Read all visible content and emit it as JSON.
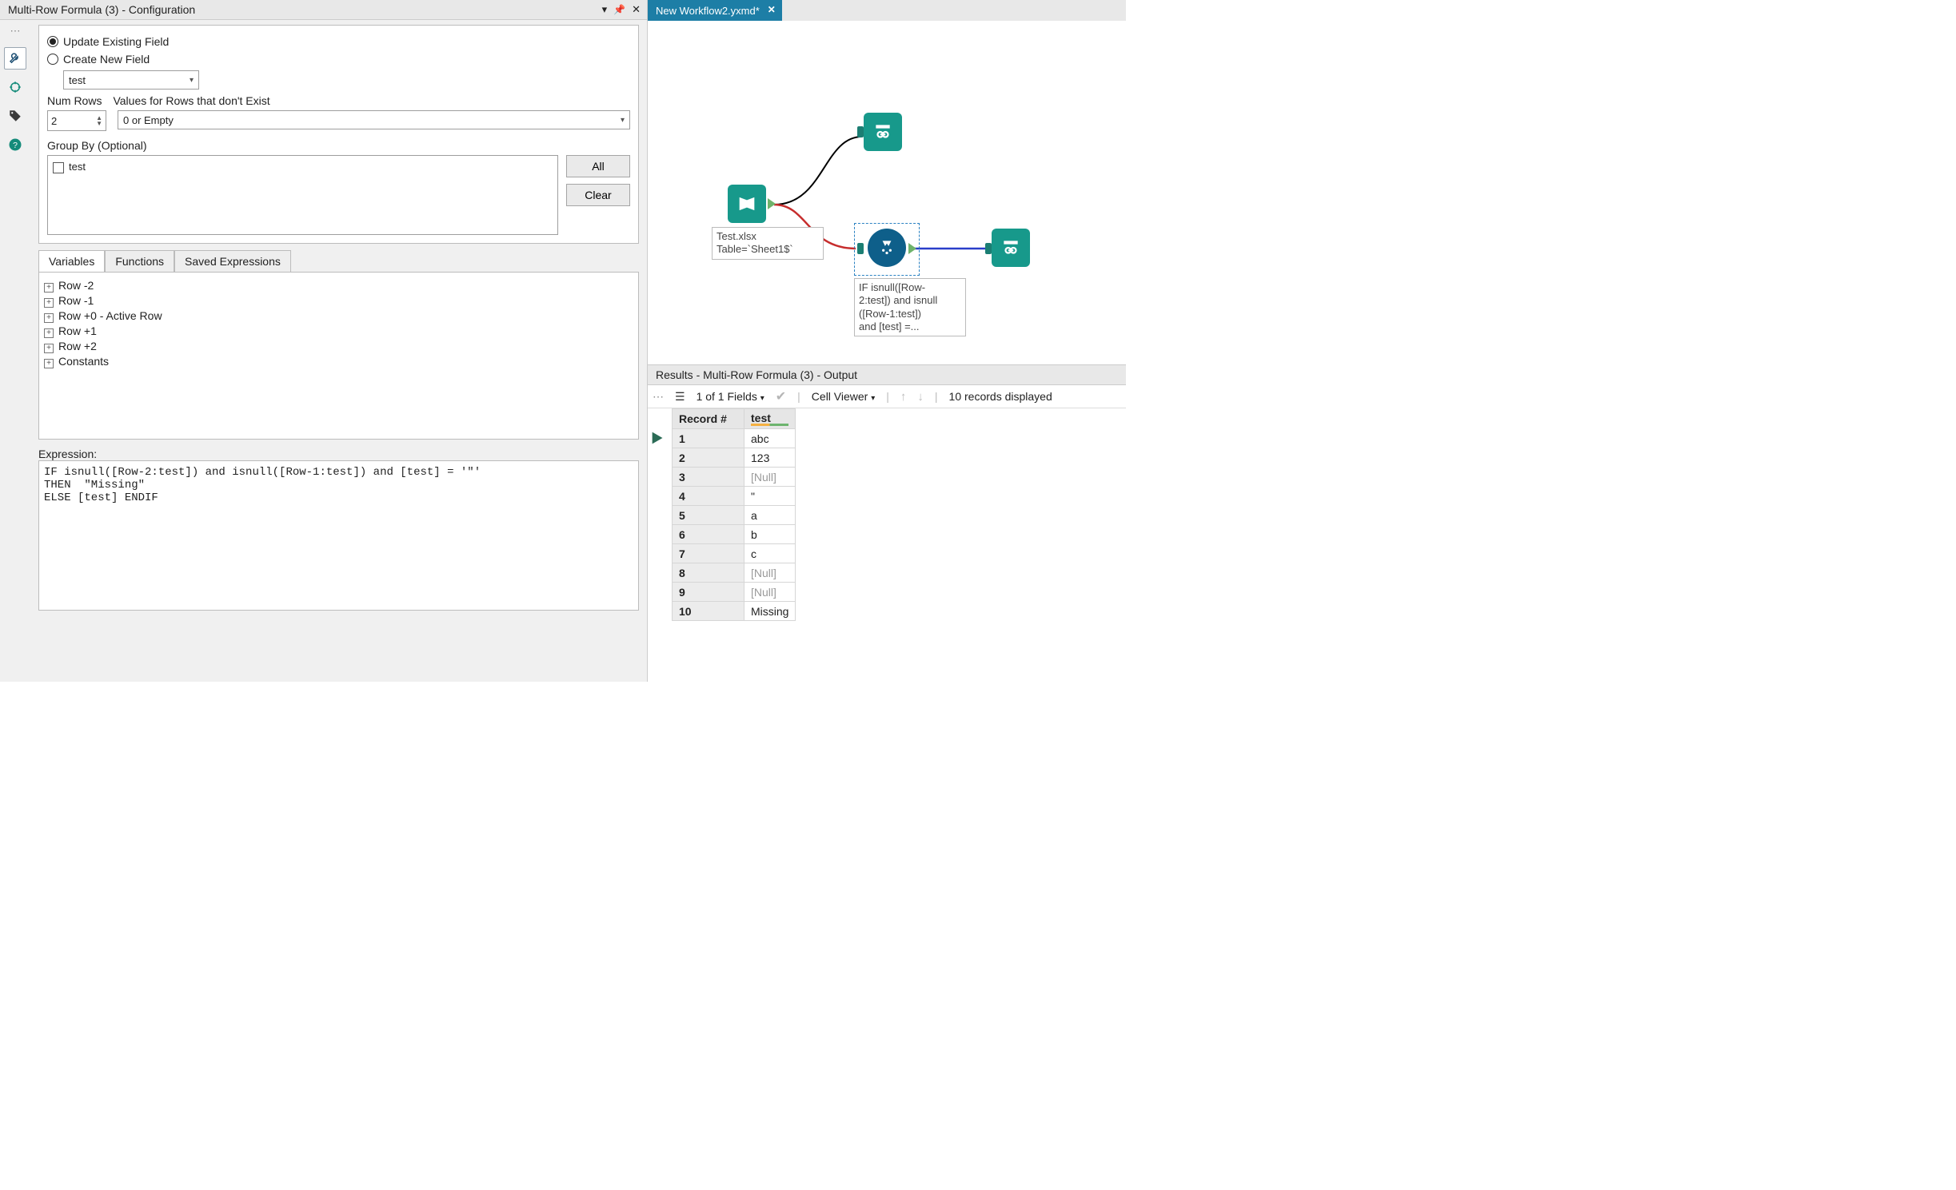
{
  "config_panel": {
    "title": "Multi-Row Formula (3) - Configuration",
    "radio_update": "Update Existing Field",
    "radio_create": "Create New  Field",
    "field_value": "test",
    "numrows_label": "Num Rows",
    "numrows_value": "2",
    "values_label": "Values for Rows that don't Exist",
    "values_value": "0 or Empty",
    "groupby_label": "Group By (Optional)",
    "groupby_item": "test",
    "btn_all": "All",
    "btn_clear": "Clear",
    "tabs": {
      "variables": "Variables",
      "functions": "Functions",
      "saved": "Saved Expressions"
    },
    "tree": [
      "Row -2",
      "Row -1",
      "Row +0 - Active Row",
      "Row +1",
      "Row +2",
      "Constants"
    ],
    "expr_label": "Expression:",
    "expression": "IF isnull([Row-2:test]) and isnull([Row-1:test]) and [test] = '\"'\nTHEN  \"Missing\"\nELSE [test] ENDIF"
  },
  "canvas": {
    "doc_tab": "New Workflow2.yxmd*",
    "input_label_l1": "Test.xlsx",
    "input_label_l2": "Table=`Sheet1$`",
    "mrf_label_l1": "IF isnull([Row-",
    "mrf_label_l2": "2:test]) and isnull",
    "mrf_label_l3": "([Row-1:test])",
    "mrf_label_l4": "and [test] =..."
  },
  "results": {
    "title": "Results - Multi-Row Formula (3) - Output",
    "fields_text": "1 of 1 Fields",
    "cellviewer": "Cell Viewer",
    "count_text": "10 records displayed",
    "columns": [
      "Record #",
      "test"
    ],
    "rows": [
      {
        "n": "1",
        "v": "abc",
        "null": false
      },
      {
        "n": "2",
        "v": "123",
        "null": false
      },
      {
        "n": "3",
        "v": "[Null]",
        "null": true
      },
      {
        "n": "4",
        "v": "\"",
        "null": false
      },
      {
        "n": "5",
        "v": "a",
        "null": false
      },
      {
        "n": "6",
        "v": "b",
        "null": false
      },
      {
        "n": "7",
        "v": "c",
        "null": false
      },
      {
        "n": "8",
        "v": "[Null]",
        "null": true
      },
      {
        "n": "9",
        "v": "[Null]",
        "null": true
      },
      {
        "n": "10",
        "v": "Missing",
        "null": false
      }
    ]
  }
}
